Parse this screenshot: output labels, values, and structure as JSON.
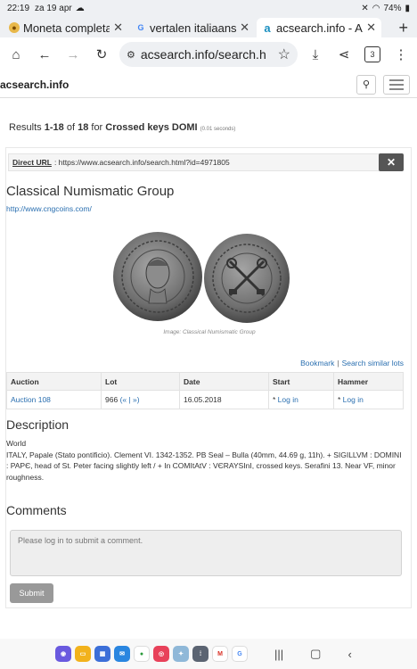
{
  "status_bar": {
    "time": "22:19",
    "date": "za 19 apr",
    "battery": "74%"
  },
  "tabs": [
    {
      "title": "Moneta completa",
      "favicon": "coin-icon",
      "active": false
    },
    {
      "title": "vertalen italiaans",
      "favicon": "google-icon",
      "active": false
    },
    {
      "title": "acsearch.info - A",
      "favicon": "acsearch-icon",
      "active": true
    }
  ],
  "toolbar": {
    "url": "acsearch.info/search.h",
    "tab_count": "3"
  },
  "site": {
    "brand": "acsearch.info"
  },
  "results": {
    "prefix": "Results ",
    "range": "1-18",
    "of": " of ",
    "total": "18",
    "for": " for ",
    "query": "Crossed keys DOMI",
    "time": "(0.01 seconds)"
  },
  "lot": {
    "direct_url_label": "Direct URL",
    "direct_url": ": https://www.acsearch.info/search.html?id=4971805",
    "close": "✕",
    "seller": "Classical Numismatic Group",
    "seller_url": "http://www.cngcoins.com/",
    "image_caption": "Image: Classical Numismatic Group",
    "actions": {
      "bookmark": "Bookmark",
      "separator": "|",
      "similar": "Search similar lots"
    },
    "table": {
      "headers": [
        "Auction",
        "Lot",
        "Date",
        "Start",
        "Hammer"
      ],
      "auction": "Auction 108",
      "lot_no": "966",
      "lot_nav": "(« | »)",
      "date": "16.05.2018",
      "start_prefix": "* ",
      "start": "Log in",
      "hammer_prefix": "* ",
      "hammer": "Log in"
    },
    "description_heading": "Description",
    "category": "World",
    "description": "ITALY, Papale (Stato pontificio). Clement VI. 1342-1352. PB Seal – Bulla (40mm, 44.69 g, 11h). + SIGILLVM : DOMINI : PAPЄ, head of St. Peter facing slightly left / + In COMItAtV : VЄRAYSInI, crossed keys. Serafini 13. Near VF, minor roughness.",
    "comments_heading": "Comments",
    "comment_placeholder": "Please log in to submit a comment.",
    "submit": "Submit"
  },
  "colors": {
    "link": "#2a6fb0",
    "close_button": "#555555",
    "submit_button": "#999999"
  }
}
